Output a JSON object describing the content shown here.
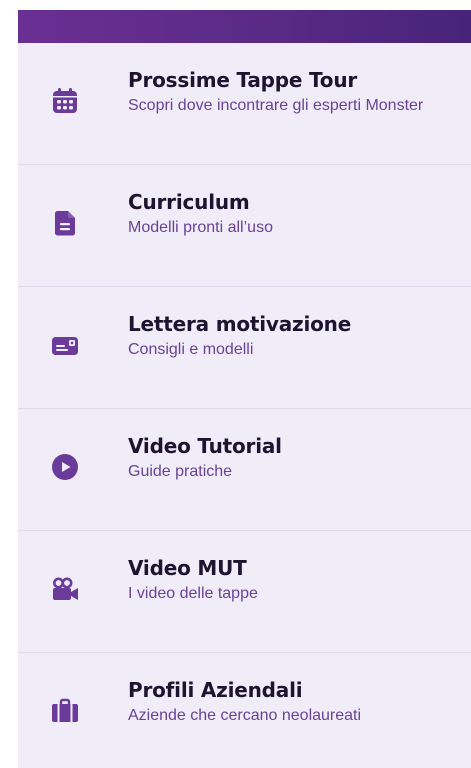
{
  "colors": {
    "accent": "#6a3b99",
    "background": "#f1edf8",
    "title": "#1f1430",
    "subtitle": "#6a4294",
    "top_bar": "#5a2a86"
  },
  "menu": {
    "items": [
      {
        "icon": "calendar-icon",
        "title": "Prossime Tappe Tour",
        "subtitle": "Scopri dove incontrare gli esperti Monster"
      },
      {
        "icon": "document-icon",
        "title": "Curriculum",
        "subtitle": "Modelli pronti all’uso"
      },
      {
        "icon": "letter-card-icon",
        "title": "Lettera motivazione",
        "subtitle": "Consigli e modelli"
      },
      {
        "icon": "play-icon",
        "title": "Video Tutorial",
        "subtitle": "Guide pratiche"
      },
      {
        "icon": "video-camera-icon",
        "title": "Video MUT",
        "subtitle": "I video delle tappe"
      },
      {
        "icon": "briefcase-icon",
        "title": "Profili Aziendali",
        "subtitle": "Aziende che cercano neolaureati"
      }
    ]
  }
}
